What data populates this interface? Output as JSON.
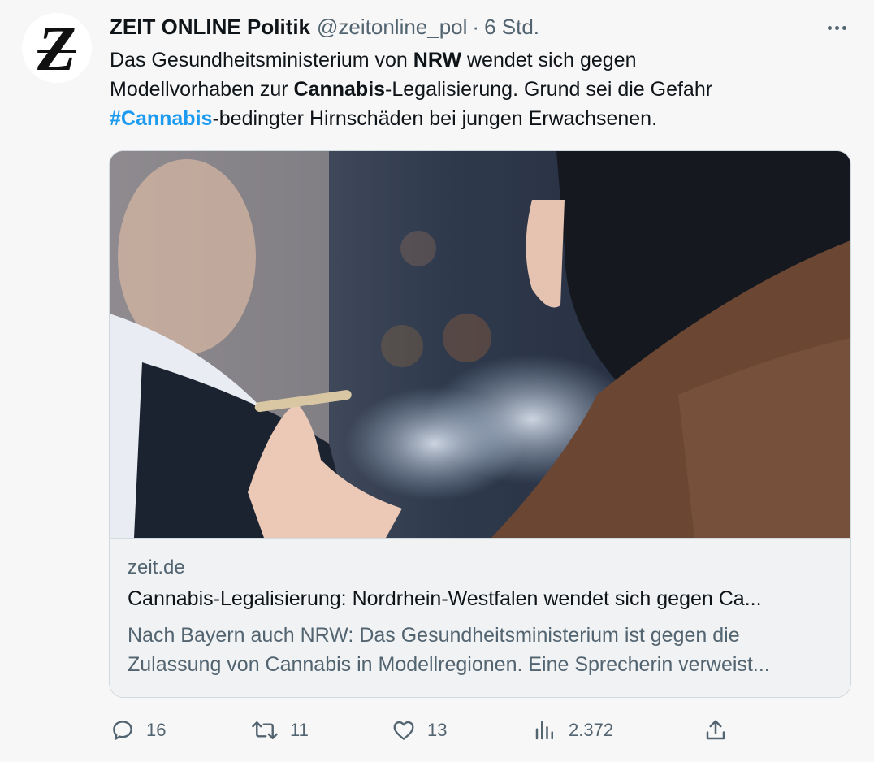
{
  "tweet": {
    "author_name": "ZEIT ONLINE Politik",
    "handle": "@zeitonline_pol",
    "separator": "·",
    "time": "6 Std.",
    "avatar_letter": "Z",
    "text": {
      "l1_a": "Das Gesundheitsministerium von ",
      "l1_b": "NRW",
      "l1_c": " wendet sich gegen",
      "l2_a": "Modellvorhaben zur ",
      "l2_b": "Cannabis",
      "l2_c": "-Legalisierung. Grund sei die Gefahr",
      "l3_hashtag": "#Cannabis",
      "l3_c": "-bedingter Hirnschäden bei jungen Erwachsenen."
    }
  },
  "card": {
    "image_icon": "smoking-person-photo",
    "domain": "zeit.de",
    "title": "Cannabis-Legalisierung: Nordrhein-Westfalen wendet sich gegen Ca...",
    "description_line1": "Nach Bayern auch NRW: Das Gesundheitsministerium ist gegen die",
    "description_line2": "Zulassung von Cannabis in Modellregionen. Eine Sprecherin verweist..."
  },
  "actions": {
    "replies": "16",
    "retweets": "11",
    "likes": "13",
    "views": "2.372",
    "icons": {
      "reply": "reply-icon",
      "retweet": "retweet-icon",
      "like": "heart-icon",
      "views": "views-icon",
      "share": "share-icon",
      "more": "more-icon"
    }
  },
  "colors": {
    "background": "#f7f7f7",
    "text": "#0f1419",
    "secondary": "#536471",
    "hashtag": "#1d9bf0",
    "card_border": "#cfd9de"
  }
}
